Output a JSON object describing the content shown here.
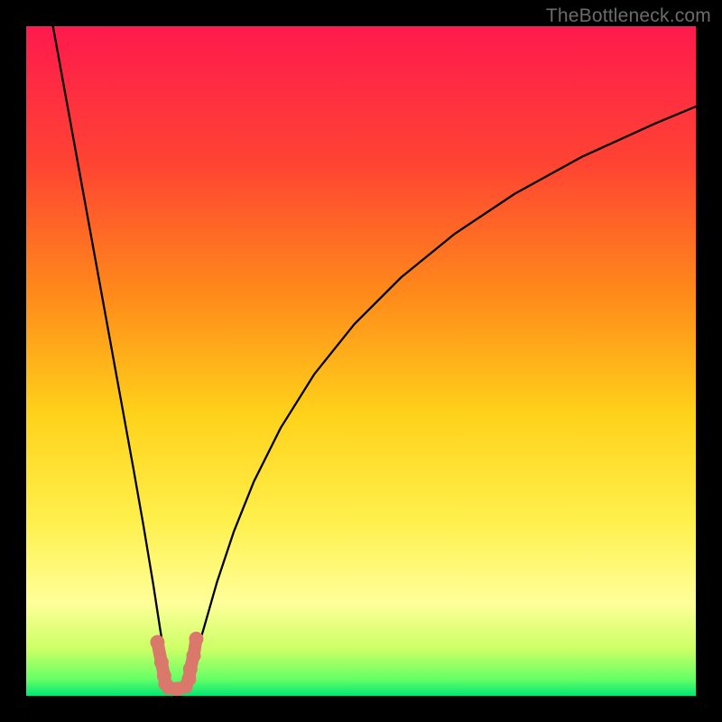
{
  "watermark": {
    "text": "TheBottleneck.com"
  },
  "chart_data": {
    "type": "line",
    "title": "",
    "xlabel": "",
    "ylabel": "",
    "xlim": [
      0,
      100
    ],
    "ylim": [
      0,
      100
    ],
    "x_optimum": 22,
    "gradient_stops": [
      {
        "pos": 0.0,
        "color": "#ff1a4d"
      },
      {
        "pos": 0.2,
        "color": "#ff4233"
      },
      {
        "pos": 0.4,
        "color": "#ff8a1a"
      },
      {
        "pos": 0.58,
        "color": "#ffd21a"
      },
      {
        "pos": 0.74,
        "color": "#fff04d"
      },
      {
        "pos": 0.86,
        "color": "#ffff99"
      },
      {
        "pos": 0.93,
        "color": "#ccff66"
      },
      {
        "pos": 0.975,
        "color": "#66ff66"
      },
      {
        "pos": 1.0,
        "color": "#00e673"
      }
    ],
    "series": [
      {
        "name": "left-branch",
        "color": "#000000",
        "x": [
          4.0,
          6.0,
          8.0,
          10.0,
          12.0,
          14.0,
          16.0,
          17.5,
          19.0,
          20.0,
          20.8,
          21.3
        ],
        "y": [
          100.0,
          89.0,
          78.0,
          67.0,
          56.0,
          45.0,
          34.0,
          25.5,
          16.5,
          10.0,
          5.0,
          2.0
        ]
      },
      {
        "name": "right-branch",
        "color": "#000000",
        "x": [
          24.0,
          25.0,
          26.5,
          28.5,
          31.0,
          34.0,
          38.0,
          43.0,
          49.0,
          56.0,
          64.0,
          73.0,
          83.0,
          94.0,
          100.0
        ],
        "y": [
          2.0,
          5.0,
          10.0,
          17.0,
          24.5,
          32.0,
          40.0,
          48.0,
          55.5,
          62.5,
          69.0,
          75.0,
          80.5,
          85.5,
          88.0
        ]
      },
      {
        "name": "valley-marker",
        "color": "#d9786b",
        "x": [
          19.6,
          20.2,
          20.6,
          20.8,
          21.3,
          22.5,
          23.8,
          24.3,
          24.5,
          25.0,
          25.4
        ],
        "y": [
          8.0,
          5.0,
          3.0,
          1.8,
          1.2,
          1.0,
          1.4,
          2.5,
          4.0,
          6.0,
          8.5
        ]
      }
    ]
  }
}
